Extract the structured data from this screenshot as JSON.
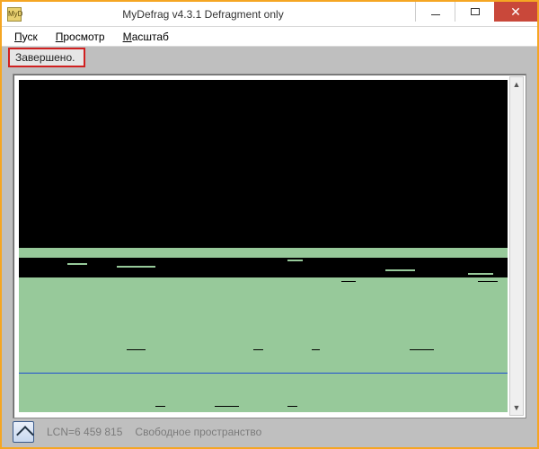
{
  "titlebar": {
    "icon_label": "MyD",
    "title": "MyDefrag v4.3.1    Defragment only"
  },
  "menubar": {
    "items": [
      {
        "label": "Пуск",
        "underline": 0
      },
      {
        "label": "Просмотр",
        "underline": 0
      },
      {
        "label": "Масштаб",
        "underline": 0
      }
    ]
  },
  "status": {
    "label": "Завершено."
  },
  "footer": {
    "lcn": "LCN=6 459 815",
    "freespace": "Свободное пространство"
  },
  "colors": {
    "free": "#97c99a",
    "used": "#000000",
    "frame": "#bfbfbf",
    "highlight": "#d02020",
    "accent": "#2050d0"
  }
}
